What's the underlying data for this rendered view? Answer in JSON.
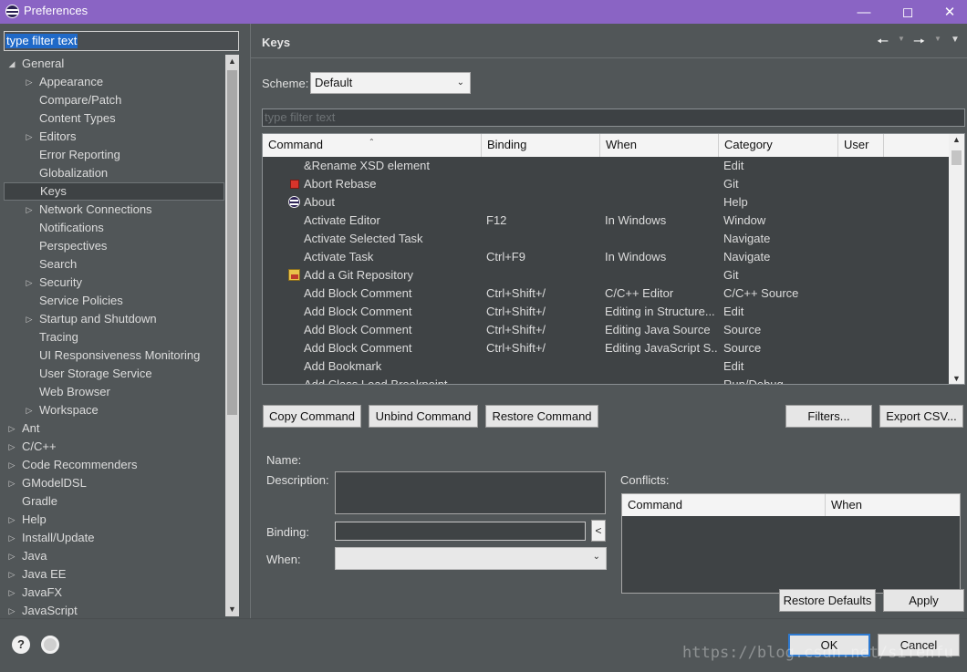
{
  "window": {
    "title": "Preferences"
  },
  "colors": {
    "titlebar": "#8a64c4",
    "background": "#515658",
    "selection": "#1f69c8",
    "default_button_border": "#2e7ad1"
  },
  "left": {
    "filter_text": "type filter text",
    "tree": [
      {
        "label": "General",
        "expanded": true,
        "level": 0
      },
      {
        "label": "Appearance",
        "expandable": true,
        "level": 1
      },
      {
        "label": "Compare/Patch",
        "level": 1
      },
      {
        "label": "Content Types",
        "level": 1
      },
      {
        "label": "Editors",
        "expandable": true,
        "level": 1
      },
      {
        "label": "Error Reporting",
        "level": 1
      },
      {
        "label": "Globalization",
        "level": 1
      },
      {
        "label": "Keys",
        "selected": true,
        "level": 1
      },
      {
        "label": "Network Connections",
        "expandable": true,
        "level": 1
      },
      {
        "label": "Notifications",
        "level": 1
      },
      {
        "label": "Perspectives",
        "level": 1
      },
      {
        "label": "Search",
        "level": 1
      },
      {
        "label": "Security",
        "expandable": true,
        "level": 1
      },
      {
        "label": "Service Policies",
        "level": 1
      },
      {
        "label": "Startup and Shutdown",
        "expandable": true,
        "level": 1
      },
      {
        "label": "Tracing",
        "level": 1
      },
      {
        "label": "UI Responsiveness Monitoring",
        "level": 1
      },
      {
        "label": "User Storage Service",
        "level": 1
      },
      {
        "label": "Web Browser",
        "level": 1
      },
      {
        "label": "Workspace",
        "expandable": true,
        "level": 1
      },
      {
        "label": "Ant",
        "expandable": true,
        "level": 0
      },
      {
        "label": "C/C++",
        "expandable": true,
        "level": 0
      },
      {
        "label": "Code Recommenders",
        "expandable": true,
        "level": 0
      },
      {
        "label": "GModelDSL",
        "expandable": true,
        "level": 0
      },
      {
        "label": "Gradle",
        "level": 0
      },
      {
        "label": "Help",
        "expandable": true,
        "level": 0
      },
      {
        "label": "Install/Update",
        "expandable": true,
        "level": 0
      },
      {
        "label": "Java",
        "expandable": true,
        "level": 0
      },
      {
        "label": "Java EE",
        "expandable": true,
        "level": 0
      },
      {
        "label": "JavaFX",
        "expandable": true,
        "level": 0
      },
      {
        "label": "JavaScript",
        "expandable": true,
        "level": 0
      }
    ]
  },
  "right": {
    "title": "Keys",
    "scheme_label": "Scheme:",
    "scheme_value": "Default",
    "filter_placeholder": "type filter text",
    "columns": [
      "Command",
      "Binding",
      "When",
      "Category",
      "User"
    ],
    "rows": [
      {
        "command": "&Rename XSD element",
        "binding": "",
        "when": "",
        "category": "Edit",
        "icon": ""
      },
      {
        "command": "Abort Rebase",
        "binding": "",
        "when": "",
        "category": "Git",
        "icon": "red-square-icon"
      },
      {
        "command": "About",
        "binding": "",
        "when": "",
        "category": "Help",
        "icon": "eclipse-icon"
      },
      {
        "command": "Activate Editor",
        "binding": "F12",
        "when": "In Windows",
        "category": "Window",
        "icon": ""
      },
      {
        "command": "Activate Selected Task",
        "binding": "",
        "when": "",
        "category": "Navigate",
        "icon": ""
      },
      {
        "command": "Activate Task",
        "binding": "Ctrl+F9",
        "when": "In Windows",
        "category": "Navigate",
        "icon": ""
      },
      {
        "command": "Add a Git Repository",
        "binding": "",
        "when": "",
        "category": "Git",
        "icon": "git-repository-icon"
      },
      {
        "command": "Add Block Comment",
        "binding": "Ctrl+Shift+/",
        "when": "C/C++ Editor",
        "category": "C/C++ Source",
        "icon": ""
      },
      {
        "command": "Add Block Comment",
        "binding": "Ctrl+Shift+/",
        "when": "Editing in Structure...",
        "category": "Edit",
        "icon": ""
      },
      {
        "command": "Add Block Comment",
        "binding": "Ctrl+Shift+/",
        "when": "Editing Java Source",
        "category": "Source",
        "icon": ""
      },
      {
        "command": "Add Block Comment",
        "binding": "Ctrl+Shift+/",
        "when": "Editing JavaScript S...",
        "category": "Source",
        "icon": ""
      },
      {
        "command": "Add Bookmark",
        "binding": "",
        "when": "",
        "category": "Edit",
        "icon": ""
      },
      {
        "command": "Add Class Load Breakpoint",
        "binding": "",
        "when": "",
        "category": "Run/Debug",
        "icon": ""
      }
    ],
    "buttons": {
      "copy_command": "Copy Command",
      "unbind_command": "Unbind Command",
      "restore_command": "Restore Command",
      "filters": "Filters...",
      "export_csv": "Export CSV...",
      "restore_defaults": "Restore Defaults",
      "apply": "Apply"
    },
    "details": {
      "name_label": "Name:",
      "description_label": "Description:",
      "binding_label": "Binding:",
      "when_label": "When:",
      "conflicts_label": "Conflicts:",
      "conflict_columns": [
        "Command",
        "When"
      ],
      "binding_button": "<"
    }
  },
  "footer": {
    "ok": "OK",
    "cancel": "Cancel",
    "watermark": "https://blog.csdn.net/sifenfu"
  }
}
